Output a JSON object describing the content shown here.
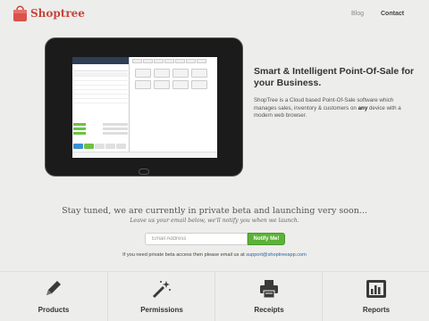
{
  "brand": {
    "name": "Shoptree",
    "accent": "#c6463b"
  },
  "nav": {
    "blog": "Blog",
    "contact": "Contact"
  },
  "hero": {
    "title": "Smart & Intelligent Point-Of-Sale for your Business.",
    "desc_before": "ShopTree is a Cloud based Point-Of-Sale software which manages sales, inventory & customers on ",
    "desc_bold": "any",
    "desc_after": " device with a modern web browser."
  },
  "signup": {
    "headline": "Stay tuned, we are currently in private beta and launching very soon...",
    "subline": "Leave us your email below, we'll notify you when we launch.",
    "email_placeholder": "Email Address",
    "button": "Notify Me!",
    "note_prefix": "If you need private beta access then please email us at ",
    "email": "support@shoptreeapp.com"
  },
  "features": [
    {
      "label": "Products",
      "icon": "pencil-icon"
    },
    {
      "label": "Permissions",
      "icon": "magic-wand-icon"
    },
    {
      "label": "Receipts",
      "icon": "printer-icon"
    },
    {
      "label": "Reports",
      "icon": "bar-chart-icon"
    }
  ],
  "colors": {
    "button_green": "#5cb238",
    "link_blue": "#2a64a6",
    "background": "#ededeb"
  }
}
